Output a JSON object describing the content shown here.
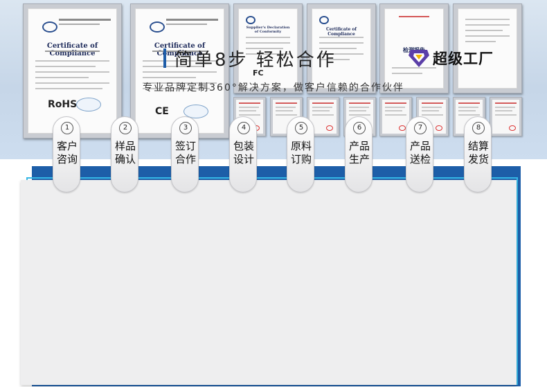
{
  "certificates": [
    {
      "title": "Certificate of Compliance",
      "mark": "RoHS"
    },
    {
      "title": "Certificate of Compliance",
      "mark": "CE"
    },
    {
      "title": "Supplier's Declaration of Conformity",
      "mark": "FC"
    },
    {
      "title": "Certificate of Compliance",
      "mark": ""
    },
    {
      "title": "检测报告",
      "mark": ""
    },
    {
      "title": "",
      "mark": ""
    }
  ],
  "section": {
    "title": "简单8步 轻松合作",
    "brand": "超级工厂",
    "subtitle": "专业品牌定制360°解决方案，做客户信赖的合作伙伴"
  },
  "steps": [
    {
      "num": "1",
      "label": "客户咨询"
    },
    {
      "num": "2",
      "label": "样品确认"
    },
    {
      "num": "3",
      "label": "签订合作"
    },
    {
      "num": "4",
      "label": "包装设计"
    },
    {
      "num": "5",
      "label": "原料订购"
    },
    {
      "num": "6",
      "label": "产品生产"
    },
    {
      "num": "7",
      "label": "产品送检"
    },
    {
      "num": "8",
      "label": "结算发货"
    }
  ],
  "colors": {
    "accent": "#1f5da8",
    "frame_cyan": "#35b7e6",
    "brand_purple": "#5b3fa8"
  }
}
